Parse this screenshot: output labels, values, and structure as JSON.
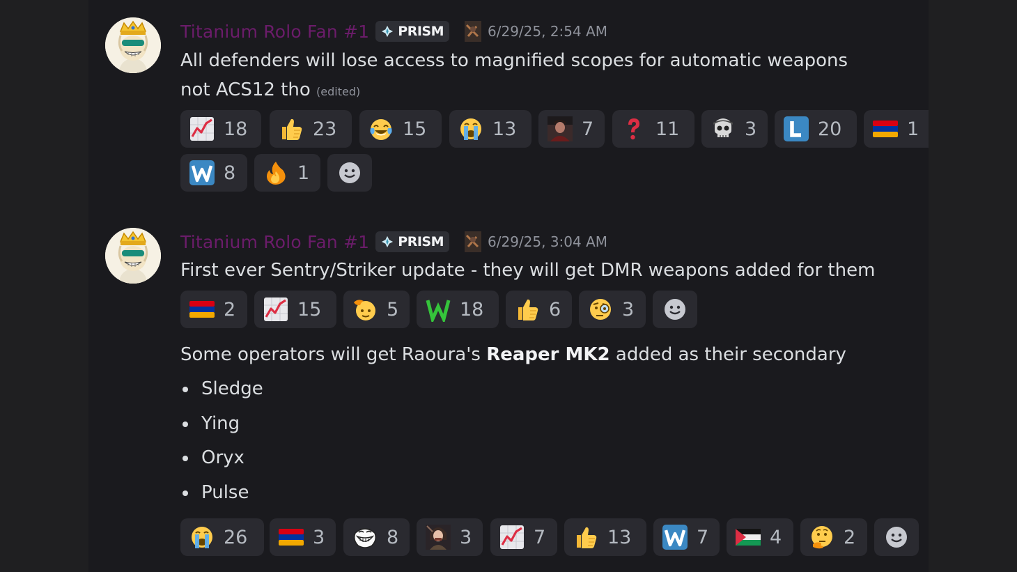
{
  "messages": [
    {
      "author": "Titanium Rolo Fan #1",
      "tag": "PRISM",
      "timestamp": "6/29/25, 2:54 AM",
      "line1": "All defenders will lose access to magnified scopes for automatic weapons",
      "line2": "not ACS12 tho",
      "edited": "(edited)",
      "reactions": [
        {
          "emoji": "chart-increasing-icon",
          "count": "18"
        },
        {
          "emoji": "thumbs-up-icon",
          "count": "23"
        },
        {
          "emoji": "tears-of-joy-icon",
          "count": "15"
        },
        {
          "emoji": "loudly-crying-icon",
          "count": "13"
        },
        {
          "emoji": "custom-portrait-icon",
          "count": "7"
        },
        {
          "emoji": "red-question-icon",
          "count": "11"
        },
        {
          "emoji": "custom-skull-soldier-icon",
          "count": "3"
        },
        {
          "emoji": "letter-l-icon",
          "count": "20"
        },
        {
          "emoji": "armenia-flag-icon",
          "count": "1"
        },
        {
          "emoji": "letter-w-icon",
          "count": "8"
        },
        {
          "emoji": "fire-icon",
          "count": "1"
        }
      ]
    },
    {
      "author": "Titanium Rolo Fan #1",
      "tag": "PRISM",
      "timestamp": "6/29/25, 3:04 AM",
      "line1": "First ever Sentry/Striker update - they will get DMR weapons added for them",
      "reactions": [
        {
          "emoji": "armenia-flag-icon",
          "count": "2"
        },
        {
          "emoji": "chart-increasing-icon",
          "count": "15"
        },
        {
          "emoji": "saluting-face-icon",
          "count": "5"
        },
        {
          "emoji": "green-w-icon",
          "count": "18"
        },
        {
          "emoji": "thumbs-up-icon",
          "count": "6"
        },
        {
          "emoji": "monocle-face-icon",
          "count": "3"
        }
      ]
    },
    {
      "text_before": "Some operators will get Raoura's ",
      "text_bold": "Reaper MK2",
      "text_after": " added as their secondary",
      "bullets": [
        "Sledge",
        "Ying",
        "Oryx",
        "Pulse"
      ],
      "reactions": [
        {
          "emoji": "loudly-crying-icon",
          "count": "26"
        },
        {
          "emoji": "armenia-flag-icon",
          "count": "3"
        },
        {
          "emoji": "trollface-icon",
          "count": "8"
        },
        {
          "emoji": "custom-character-icon",
          "count": "3"
        },
        {
          "emoji": "chart-increasing-icon",
          "count": "7"
        },
        {
          "emoji": "thumbs-up-icon",
          "count": "13"
        },
        {
          "emoji": "letter-w-icon",
          "count": "7"
        },
        {
          "emoji": "palestine-flag-icon",
          "count": "4"
        },
        {
          "emoji": "thinking-face-icon",
          "count": "2"
        }
      ]
    }
  ],
  "colors": {
    "username": "#6b1c6a",
    "background": "#1a1a1e",
    "reaction_bg": "#2a2a30",
    "text": "#dbdee1"
  }
}
